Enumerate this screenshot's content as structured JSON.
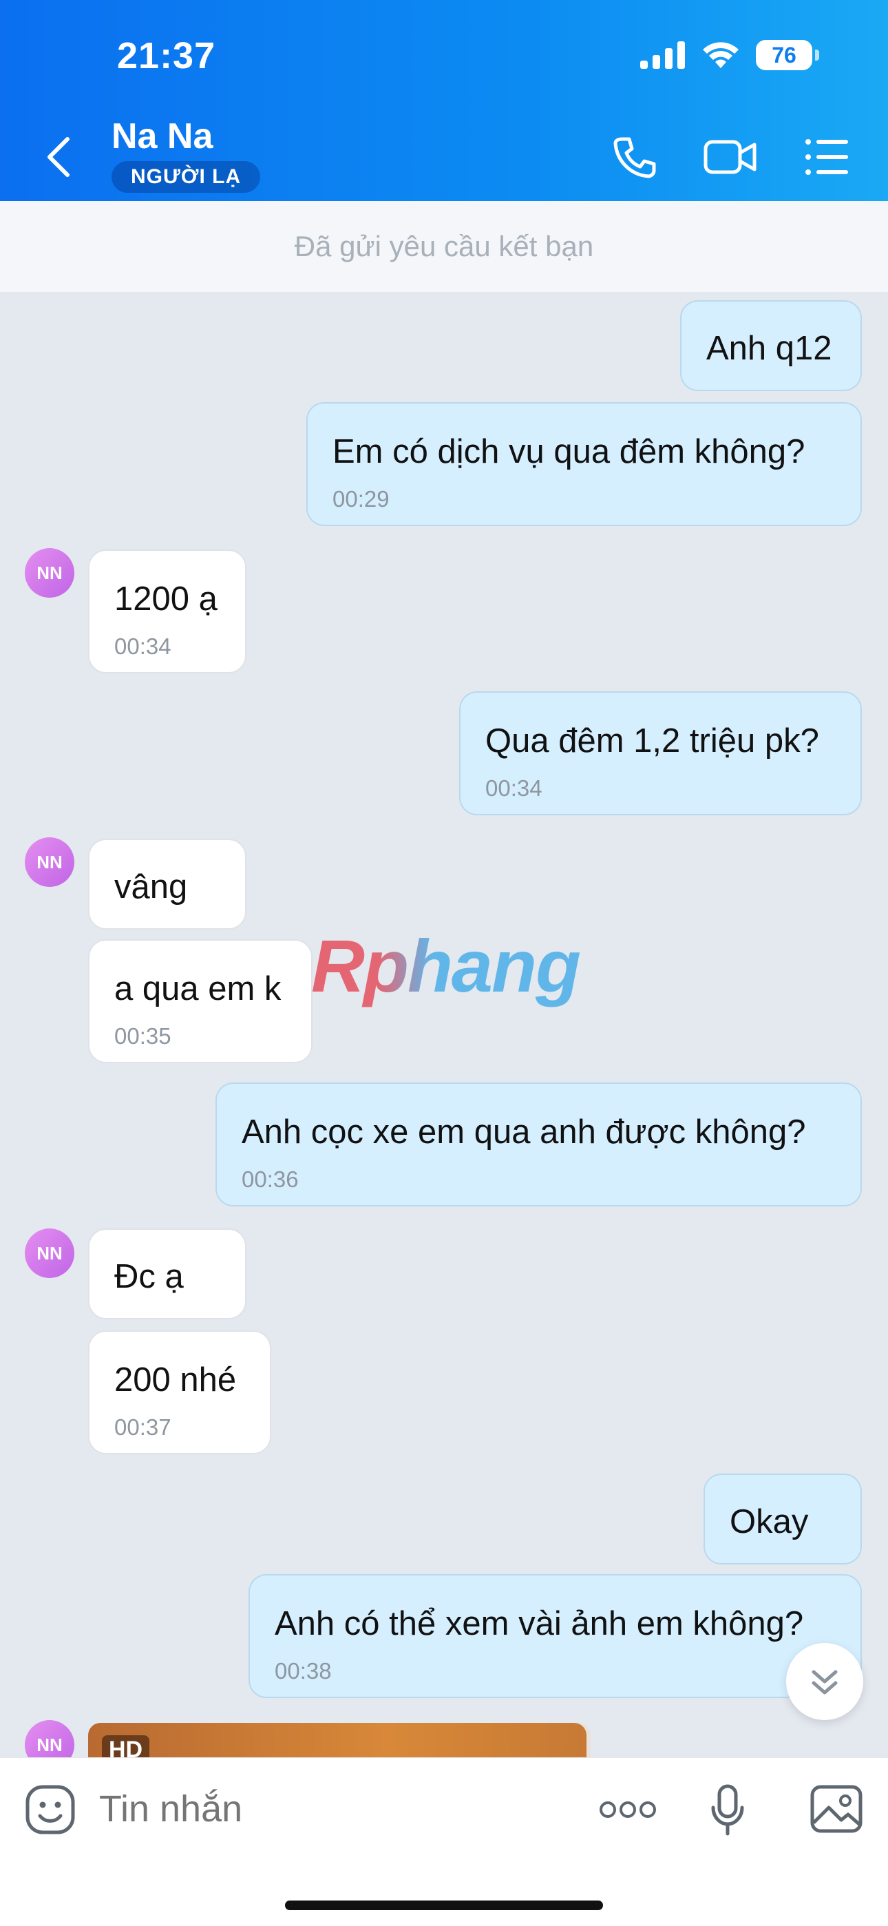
{
  "status_bar": {
    "time": "21:37",
    "battery": "76"
  },
  "header": {
    "contact_name": "Na Na",
    "badge": "NGƯỜI LẠ",
    "icons": [
      "back-icon",
      "phone-icon",
      "video-call-icon",
      "menu-list-icon"
    ]
  },
  "friend_request_bar": {
    "text": "Đã gửi yêu cầu kết bạn"
  },
  "messages": [
    {
      "side": "out",
      "text": "Anh q12",
      "time": ""
    },
    {
      "side": "out",
      "text": "Em có dịch vụ qua đêm không?",
      "time": "00:29"
    },
    {
      "side": "in",
      "text": "1200 ạ",
      "time": "00:34",
      "avatar": "NN"
    },
    {
      "side": "out",
      "text": "Qua đêm 1,2 triệu pk?",
      "time": "00:34"
    },
    {
      "side": "in",
      "text": "vâng",
      "time": "",
      "avatar": "NN"
    },
    {
      "side": "in",
      "text": "a qua em k",
      "time": "00:35"
    },
    {
      "side": "out",
      "text": "Anh cọc xe em qua anh được không?",
      "time": "00:36"
    },
    {
      "side": "in",
      "text": "Đc ạ",
      "time": "",
      "avatar": "NN"
    },
    {
      "side": "in",
      "text": "200 nhé",
      "time": "00:37"
    },
    {
      "side": "out",
      "text": "Okay",
      "time": ""
    },
    {
      "side": "out",
      "text": "Anh có thể xem vài ảnh em không?",
      "time": "00:38"
    }
  ],
  "media_message": {
    "avatar": "NN",
    "badge": "HD"
  },
  "watermark": "Rphang",
  "composer": {
    "placeholder": "Tin nhắn",
    "icons": [
      "emoji-icon",
      "more-dots-icon",
      "microphone-icon",
      "image-icon"
    ]
  },
  "colors": {
    "header": "#0c8cf2",
    "outgoing_bubble": "#d5efff",
    "incoming_bubble": "#ffffff",
    "background": "#e4e8ef"
  }
}
